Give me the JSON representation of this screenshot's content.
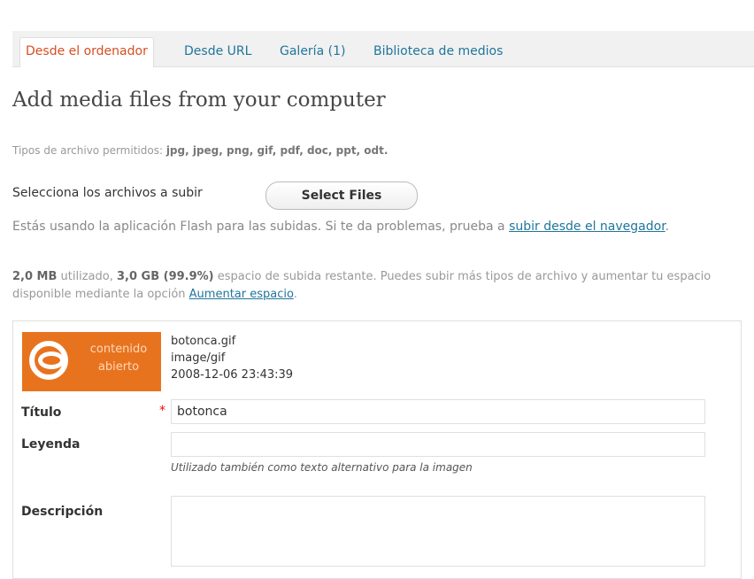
{
  "tabs": [
    {
      "label": "Desde el ordenador",
      "active": true
    },
    {
      "label": "Desde URL",
      "active": false
    },
    {
      "label": "Galería (1)",
      "active": false
    },
    {
      "label": "Biblioteca de medios",
      "active": false
    }
  ],
  "heading": "Add media files from your computer",
  "allowed_types": {
    "prefix": "Tipos de archivo permitidos: ",
    "list": "jpg, jpeg, png, gif, pdf, doc, ppt, odt."
  },
  "select": {
    "label": "Selecciona los archivos a subir",
    "button": "Select Files"
  },
  "flash_notice": {
    "text": "Estás usando la aplicación Flash para las subidas. Si te da problemas, prueba a ",
    "link": "subir desde el navegador",
    "suffix": "."
  },
  "quota": {
    "used": "2,0 MB",
    "used_suffix": " utilizado, ",
    "remaining": "3,0 GB (99.9%)",
    "text": " espacio de subida restante. Puedes subir más tipos de archivo y aumentar tu espacio disponible mediante la opción ",
    "link": "Aumentar espacio",
    "suffix": "."
  },
  "media": {
    "thumbnail_text_line1": "contenido",
    "thumbnail_text_line2": "abierto",
    "filename": "botonca.gif",
    "mime": "image/gif",
    "date": "2008-12-06 23:43:39",
    "title_label": "Título",
    "required_mark": "*",
    "title_value": "botonca",
    "caption_label": "Leyenda",
    "caption_value": "",
    "caption_hint": "Utilizado también como texto alternativo para la imagen",
    "description_label": "Descripción",
    "description_value": ""
  },
  "colors": {
    "accent": "#21759b",
    "active_tab": "#d54e21",
    "thumb_bg": "#e8731f"
  }
}
